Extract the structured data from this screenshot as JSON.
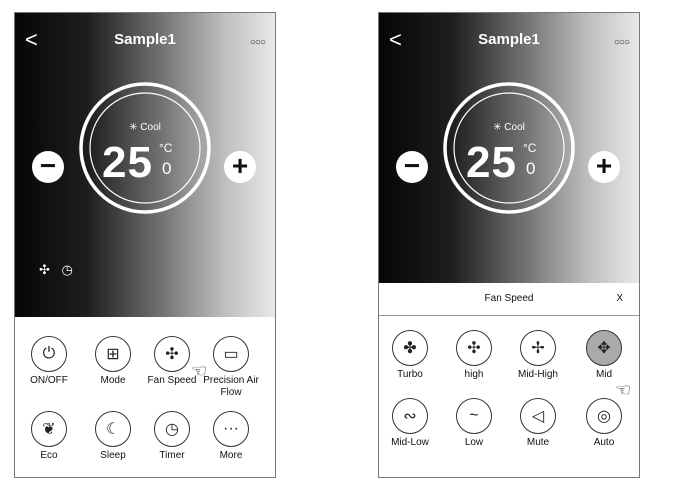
{
  "left_screen": {
    "back_glyph": "<",
    "title": "Sample1",
    "more_glyph": "○○○",
    "mode_icon": "snowflake-icon",
    "mode_label": "Cool",
    "temperature": "25",
    "unit_c": "°C",
    "unit_decimal": "0",
    "minus_glyph": "−",
    "plus_glyph": "+",
    "buttons": [
      {
        "label": "ON/OFF",
        "icon": "power-icon",
        "glyph": "⏻"
      },
      {
        "label": "Mode",
        "icon": "mode-icon",
        "glyph": "⊞"
      },
      {
        "label": "Fan Speed",
        "icon": "fan-icon",
        "glyph": "✣"
      },
      {
        "label": "Precision Air Flow",
        "icon": "airflow-icon",
        "glyph": "▭"
      },
      {
        "label": "Eco",
        "icon": "leaf-icon",
        "glyph": "❦"
      },
      {
        "label": "Sleep",
        "icon": "moon-icon",
        "glyph": "☾"
      },
      {
        "label": "Timer",
        "icon": "timer-icon",
        "glyph": "◷"
      },
      {
        "label": "More",
        "icon": "more-icon",
        "glyph": "···"
      }
    ]
  },
  "right_screen": {
    "back_glyph": "<",
    "title": "Sample1",
    "more_glyph": "○○○",
    "mode_label": "Cool",
    "temperature": "25",
    "unit_c": "°C",
    "unit_decimal": "0",
    "minus_glyph": "−",
    "plus_glyph": "+",
    "fan_panel": {
      "title": "Fan Speed",
      "close": "X",
      "selected": "Mid",
      "options": [
        {
          "label": "Turbo",
          "icon": "fan-turbo-icon",
          "glyph": "✤"
        },
        {
          "label": "high",
          "icon": "fan-high-icon",
          "glyph": "✣"
        },
        {
          "label": "Mid-High",
          "icon": "fan-mid-high-icon",
          "glyph": "✢"
        },
        {
          "label": "Mid",
          "icon": "fan-mid-icon",
          "glyph": "✥"
        },
        {
          "label": "Mid-Low",
          "icon": "fan-mid-low-icon",
          "glyph": "∾"
        },
        {
          "label": "Low",
          "icon": "fan-low-icon",
          "glyph": "~"
        },
        {
          "label": "Mute",
          "icon": "mute-icon",
          "glyph": "◁"
        },
        {
          "label": "Auto",
          "icon": "auto-icon",
          "glyph": "◎"
        }
      ]
    }
  },
  "colors": {
    "dial_ring": "#ffffff",
    "selected_option": "#aaaaaa",
    "gradient_dark": "#060606",
    "gradient_light": "#e9e9e9"
  }
}
